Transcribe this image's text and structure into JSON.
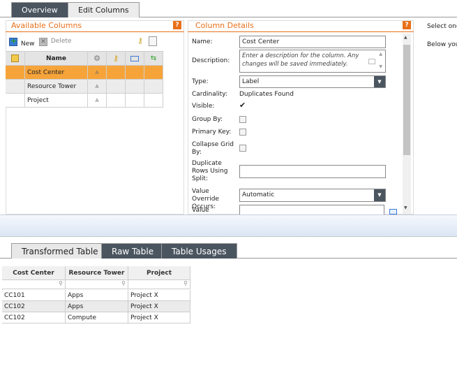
{
  "top_tabs": [
    {
      "label": "Overview"
    },
    {
      "label": "Edit Columns"
    }
  ],
  "available": {
    "title": "Available Columns",
    "help": "?",
    "toolbar": {
      "new_label": "New",
      "delete_label": "Delete"
    },
    "columns": {
      "name": "Name"
    },
    "rows": [
      {
        "name": "Cost Center",
        "type": "A",
        "selected": true
      },
      {
        "name": "Resource Tower",
        "type": "A",
        "selected": false
      },
      {
        "name": "Project",
        "type": "A",
        "selected": false
      }
    ]
  },
  "details": {
    "title": "Column Details",
    "help": "?",
    "name_label": "Name:",
    "name_value": "Cost Center",
    "description_label": "Description:",
    "description_placeholder": "Enter a description for the column. Any changes will be saved immediately.",
    "type_label": "Type:",
    "type_value": "Label",
    "cardinality_label": "Cardinality:",
    "cardinality_value": "Duplicates Found",
    "visible_label": "Visible:",
    "visible_checked": true,
    "groupby_label": "Group By:",
    "primary_label": "Primary Key:",
    "collapse_label": "Collapse Grid By:",
    "duplicate_label": "Duplicate Rows Using Split:",
    "override_label": "Value Override Occurs:",
    "override_value": "Automatic",
    "value_label": "Value"
  },
  "right_text": {
    "line1": "Select one",
    "line2": "Below you"
  },
  "bottom_tabs": [
    {
      "label": "Transformed Table"
    },
    {
      "label": "Raw Table"
    },
    {
      "label": "Table Usages"
    }
  ],
  "table": {
    "headers": [
      "Cost Center",
      "Resource Tower",
      "Project"
    ],
    "rows": [
      [
        "CC101",
        "Apps",
        "Project X"
      ],
      [
        "CC102",
        "Apps",
        "Project X"
      ],
      [
        "CC102",
        "Compute",
        "Project X"
      ]
    ]
  }
}
